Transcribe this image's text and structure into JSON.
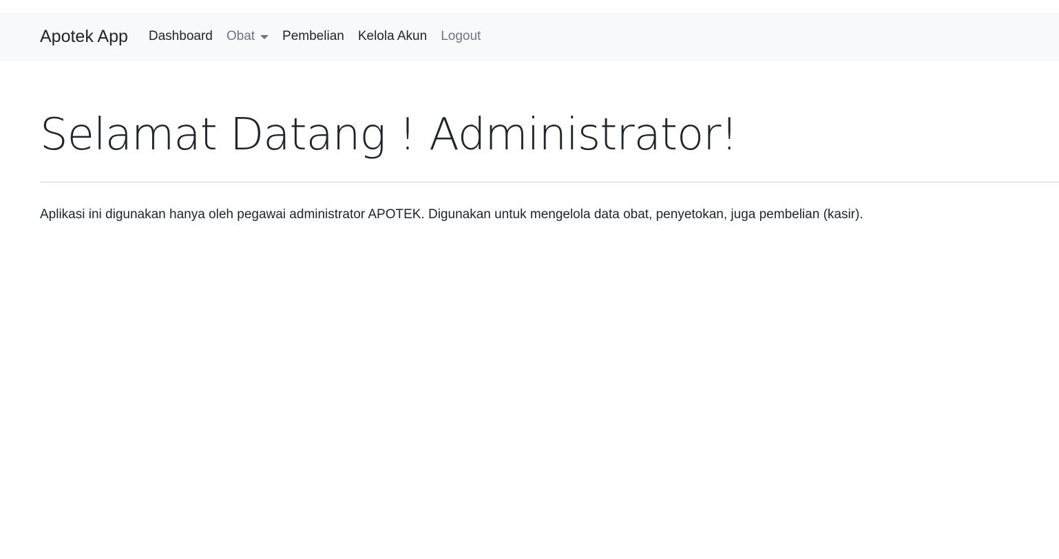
{
  "navbar": {
    "brand": "Apotek App",
    "items": [
      {
        "label": "Dashboard"
      },
      {
        "label": "Obat"
      },
      {
        "label": "Pembelian"
      },
      {
        "label": "Kelola Akun"
      },
      {
        "label": "Logout"
      }
    ]
  },
  "main": {
    "heading": "Selamat Datang ! Administrator!",
    "description": "Aplikasi ini digunakan hanya oleh pegawai administrator APOTEK. Digunakan untuk mengelola data obat, penyetokan, juga pembelian (kasir)."
  },
  "colors": {
    "navbar_bg": "#f8f9fa",
    "text": "#212529",
    "muted": "#6c757d"
  }
}
